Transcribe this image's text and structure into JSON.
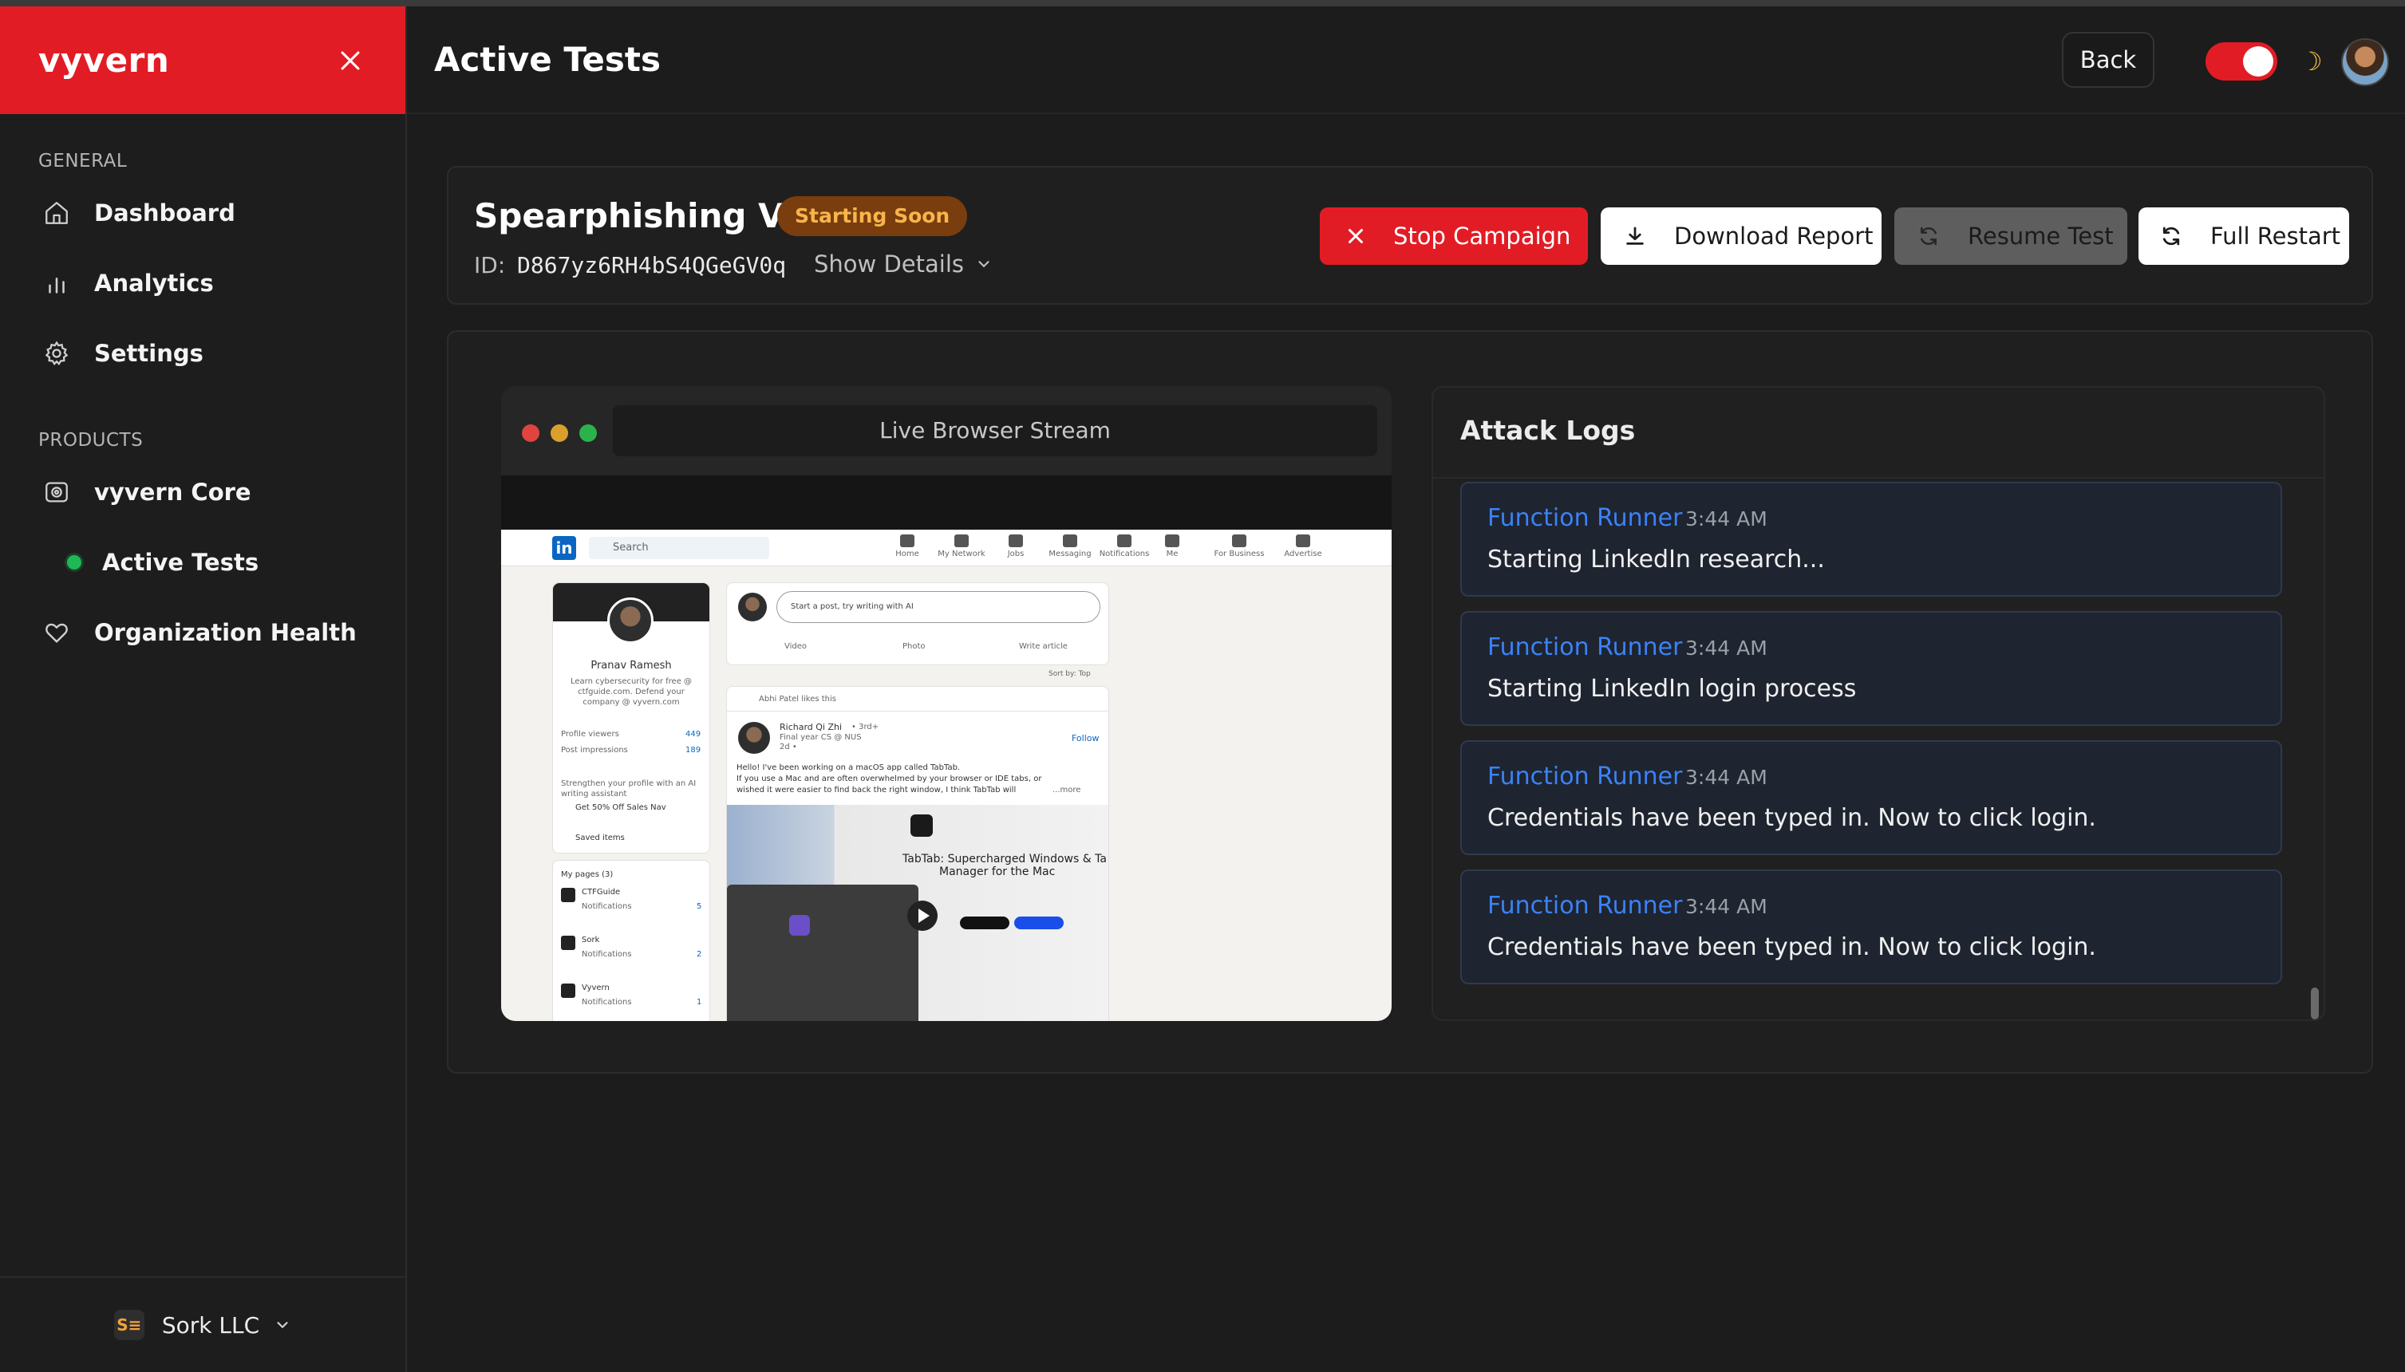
{
  "sidebar": {
    "brand": "vyvern",
    "general_label": "GENERAL",
    "general_items": [
      {
        "label": "Dashboard",
        "icon": "home-icon"
      },
      {
        "label": "Analytics",
        "icon": "bar-chart-icon"
      },
      {
        "label": "Settings",
        "icon": "gear-icon"
      }
    ],
    "products_label": "PRODUCTS",
    "product_items": [
      {
        "label": "vyvern Core",
        "icon": "core-icon"
      },
      {
        "label": "Active Tests",
        "icon": "green-dot-icon",
        "active": true
      },
      {
        "label": "Organization Health",
        "icon": "heart-icon"
      }
    ],
    "org": {
      "logo_text": "S≡",
      "name": "Sork LLC"
    }
  },
  "header": {
    "title": "Active Tests",
    "back_label": "Back",
    "dark_mode_on": true
  },
  "campaign": {
    "name": "Spearphishing V1",
    "status": "Starting Soon",
    "id_label": "ID:",
    "id_value": "D867yz6RH4bS4QGeGV0q",
    "show_details": "Show Details",
    "buttons": {
      "stop": "Stop Campaign",
      "download": "Download Report",
      "resume": "Resume Test",
      "restart": "Full Restart"
    }
  },
  "stream": {
    "title": "Live Browser Stream",
    "page": {
      "search": "Search",
      "nav": [
        "Home",
        "My Network",
        "Jobs",
        "Messaging",
        "Notifications",
        "Me",
        "For Business",
        "Advertise"
      ],
      "profile_name": "Pranav Ramesh",
      "profile_bio": [
        "Learn cybersecurity for free @",
        "ctfguide.com. Defend your",
        "company @ vyvern.com"
      ],
      "stats": [
        {
          "label": "Profile viewers",
          "value": "449"
        },
        {
          "label": "Post impressions",
          "value": "189"
        }
      ],
      "premium_text": [
        "Strengthen your profile with an AI",
        "writing assistant"
      ],
      "premium_cta": "Get 50% Off Sales Nav",
      "saved_items": "Saved items",
      "my_pages_label": "My pages (3)",
      "pages": [
        {
          "name": "CTFGuide",
          "sub": "Notifications",
          "count": "5"
        },
        {
          "name": "Sork",
          "sub": "Notifications",
          "count": "2"
        },
        {
          "name": "Vyvern",
          "sub": "Notifications",
          "count": "1"
        }
      ],
      "post_placeholder": "Start a post, try writing with AI",
      "post_actions": [
        "Video",
        "Photo",
        "Write article"
      ],
      "sort": "Sort by: Top",
      "feed_activity": "Abhi Patel likes this",
      "author": "Richard Qi Zhi",
      "author_degree": "• 3rd+",
      "author_title": "Final year CS @ NUS",
      "author_time": "2d •",
      "follow": "Follow",
      "post_lines": [
        "Hello! I've been working on a macOS app called TabTab.",
        "If you use a Mac and are often overwhelmed by your browser or IDE tabs, or",
        "wished it were easier to find back the right window, I think TabTab will"
      ],
      "more": "...more",
      "media_title": [
        "TabTab: Supercharged Windows & Ta",
        "Manager for the Mac"
      ]
    }
  },
  "logs": {
    "title": "Attack Logs",
    "items": [
      {
        "source": "Function Runner",
        "time": "3:44 AM",
        "message": "Starting LinkedIn research..."
      },
      {
        "source": "Function Runner",
        "time": "3:44 AM",
        "message": "Starting LinkedIn login process"
      },
      {
        "source": "Function Runner",
        "time": "3:44 AM",
        "message": "Credentials have been typed in. Now to click login."
      },
      {
        "source": "Function Runner",
        "time": "3:44 AM",
        "message": "Credentials have been typed in. Now to click login."
      }
    ]
  },
  "colors": {
    "accent": "#e21c25",
    "badge_bg": "#7a3d0e",
    "badge_text": "#f7b54b",
    "log_title": "#3b82f6",
    "active_dot": "#1db954"
  }
}
